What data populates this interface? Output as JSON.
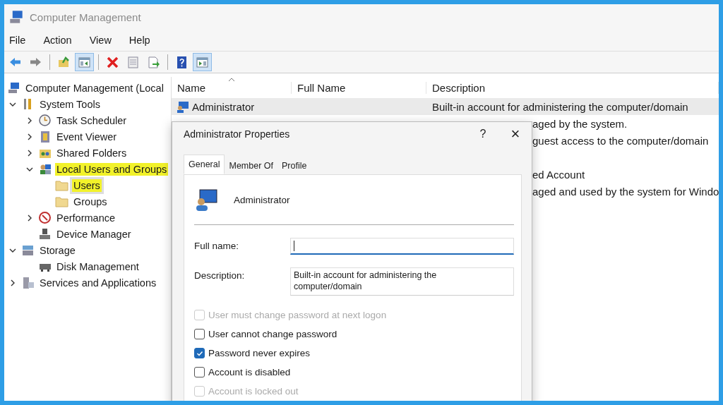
{
  "window": {
    "title": "Computer Management"
  },
  "menu": [
    "File",
    "Action",
    "View",
    "Help"
  ],
  "toolbar": [
    {
      "kind": "back",
      "pressed": false
    },
    {
      "kind": "forward",
      "pressed": false
    },
    {
      "kind": "separator"
    },
    {
      "kind": "up",
      "pressed": false
    },
    {
      "kind": "tree",
      "pressed": true
    },
    {
      "kind": "separator"
    },
    {
      "kind": "delete",
      "pressed": false
    },
    {
      "kind": "properties",
      "pressed": false
    },
    {
      "kind": "export",
      "pressed": false
    },
    {
      "kind": "separator"
    },
    {
      "kind": "help",
      "pressed": false
    },
    {
      "kind": "pane",
      "pressed": true
    }
  ],
  "tree": [
    {
      "label": "Computer Management (Local",
      "kind": "computer",
      "selected": false,
      "highlighted": false,
      "children": [
        {
          "label": "System Tools",
          "kind": "tools",
          "selected": false,
          "highlighted": false,
          "expanded": true,
          "children": [
            {
              "label": "Task Scheduler",
              "kind": "clock",
              "selected": false,
              "highlighted": false,
              "expanded": false
            },
            {
              "label": "Event Viewer",
              "kind": "log",
              "selected": false,
              "highlighted": false,
              "expanded": false
            },
            {
              "label": "Shared Folders",
              "kind": "share",
              "selected": false,
              "highlighted": false,
              "expanded": false
            },
            {
              "label": "Local Users and Groups",
              "kind": "users",
              "selected": false,
              "highlighted": true,
              "expanded": true,
              "children": [
                {
                  "label": "Users",
                  "kind": "folder",
                  "selected": true,
                  "highlighted": true
                },
                {
                  "label": "Groups",
                  "kind": "folder",
                  "selected": false,
                  "highlighted": false
                }
              ]
            },
            {
              "label": "Performance",
              "kind": "gauge",
              "selected": false,
              "highlighted": false,
              "expanded": false
            },
            {
              "label": "Device Manager",
              "kind": "device",
              "selected": false,
              "highlighted": false
            }
          ]
        },
        {
          "label": "Storage",
          "kind": "storage",
          "selected": false,
          "highlighted": false,
          "expanded": true,
          "children": [
            {
              "label": "Disk Management",
              "kind": "disk",
              "selected": false,
              "highlighted": false
            }
          ]
        },
        {
          "label": "Services and Applications",
          "kind": "services",
          "selected": false,
          "highlighted": false,
          "expanded": false
        }
      ]
    }
  ],
  "table": {
    "columns": [
      "Name",
      "Full Name",
      "Description"
    ],
    "rows": [
      {
        "kind": "full",
        "name": "Administrator",
        "description": "Built-in account for administering the computer/domain",
        "selected": true
      },
      {
        "kind": "covered",
        "description": "aged by the system.",
        "selected": false
      },
      {
        "kind": "covered",
        "description": "guest access to the computer/domain",
        "selected": false
      },
      {
        "kind": "covered",
        "selected": false
      },
      {
        "kind": "covered",
        "description": "ed Account",
        "selected": false
      },
      {
        "kind": "covered",
        "description": "aged and used by the system for Windo",
        "selected": false
      }
    ]
  },
  "dialog": {
    "title": "Administrator Properties",
    "help": "?",
    "close": "×",
    "tabs": [
      {
        "label": "General",
        "selected": true
      },
      {
        "label": "Member Of",
        "selected": false
      },
      {
        "label": "Profile",
        "selected": false
      }
    ],
    "user_name": "Administrator",
    "fields": [
      {
        "label": "Full name:",
        "focused": true
      },
      {
        "label": "Description:",
        "value": "Built-in account for administering the computer/domain",
        "focused": false
      }
    ],
    "checkboxes": [
      {
        "label": "User must change password at next logon",
        "checked": false,
        "disabled": true
      },
      {
        "label": "User cannot change password",
        "checked": false,
        "disabled": false
      },
      {
        "label": "Password never expires",
        "checked": true,
        "disabled": false
      },
      {
        "label": "Account is disabled",
        "checked": false,
        "disabled": false
      },
      {
        "label": "Account is locked out",
        "checked": false,
        "disabled": true
      }
    ]
  }
}
